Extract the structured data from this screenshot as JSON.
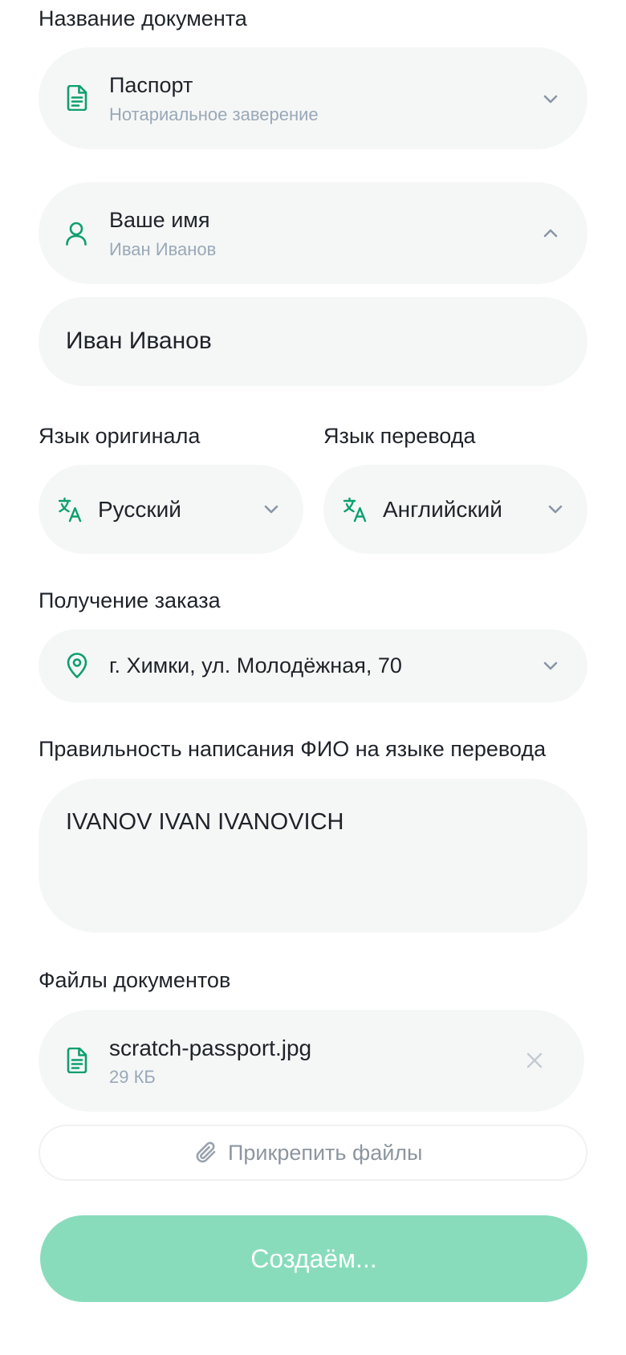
{
  "colors": {
    "accent": "#0e9f6e",
    "field_bg": "#f5f7f6",
    "muted_text": "#9aa8b8",
    "submit_bg": "#88dcbc"
  },
  "document": {
    "label": "Название документа",
    "title": "Паспорт",
    "subtitle": "Нотариальное заверение",
    "icon": "document-icon",
    "chevron": "chevron-down-icon"
  },
  "name": {
    "title": "Ваше имя",
    "subtitle": "Иван Иванов",
    "icon": "user-icon",
    "chevron": "chevron-up-icon",
    "input_value": "Иван Иванов"
  },
  "languages": {
    "original_label": "Язык оригинала",
    "original_value": "Русский",
    "target_label": "Язык перевода",
    "target_value": "Английский",
    "icon": "translate-icon"
  },
  "pickup": {
    "label": "Получение заказа",
    "value": "г. Химки, ул. Молодёжная, 70",
    "icon": "location-pin-icon"
  },
  "name_spelling": {
    "label": "Правильность написания ФИО на языке перевода",
    "value": "IVANOV IVAN IVANOVICH"
  },
  "files": {
    "label": "Файлы документов",
    "items": [
      {
        "name": "scratch-passport.jpg",
        "size": "29 КБ",
        "icon": "document-icon"
      }
    ],
    "attach_label": "Прикрепить файлы",
    "attach_icon": "paperclip-icon"
  },
  "submit": {
    "label": "Создаём..."
  }
}
